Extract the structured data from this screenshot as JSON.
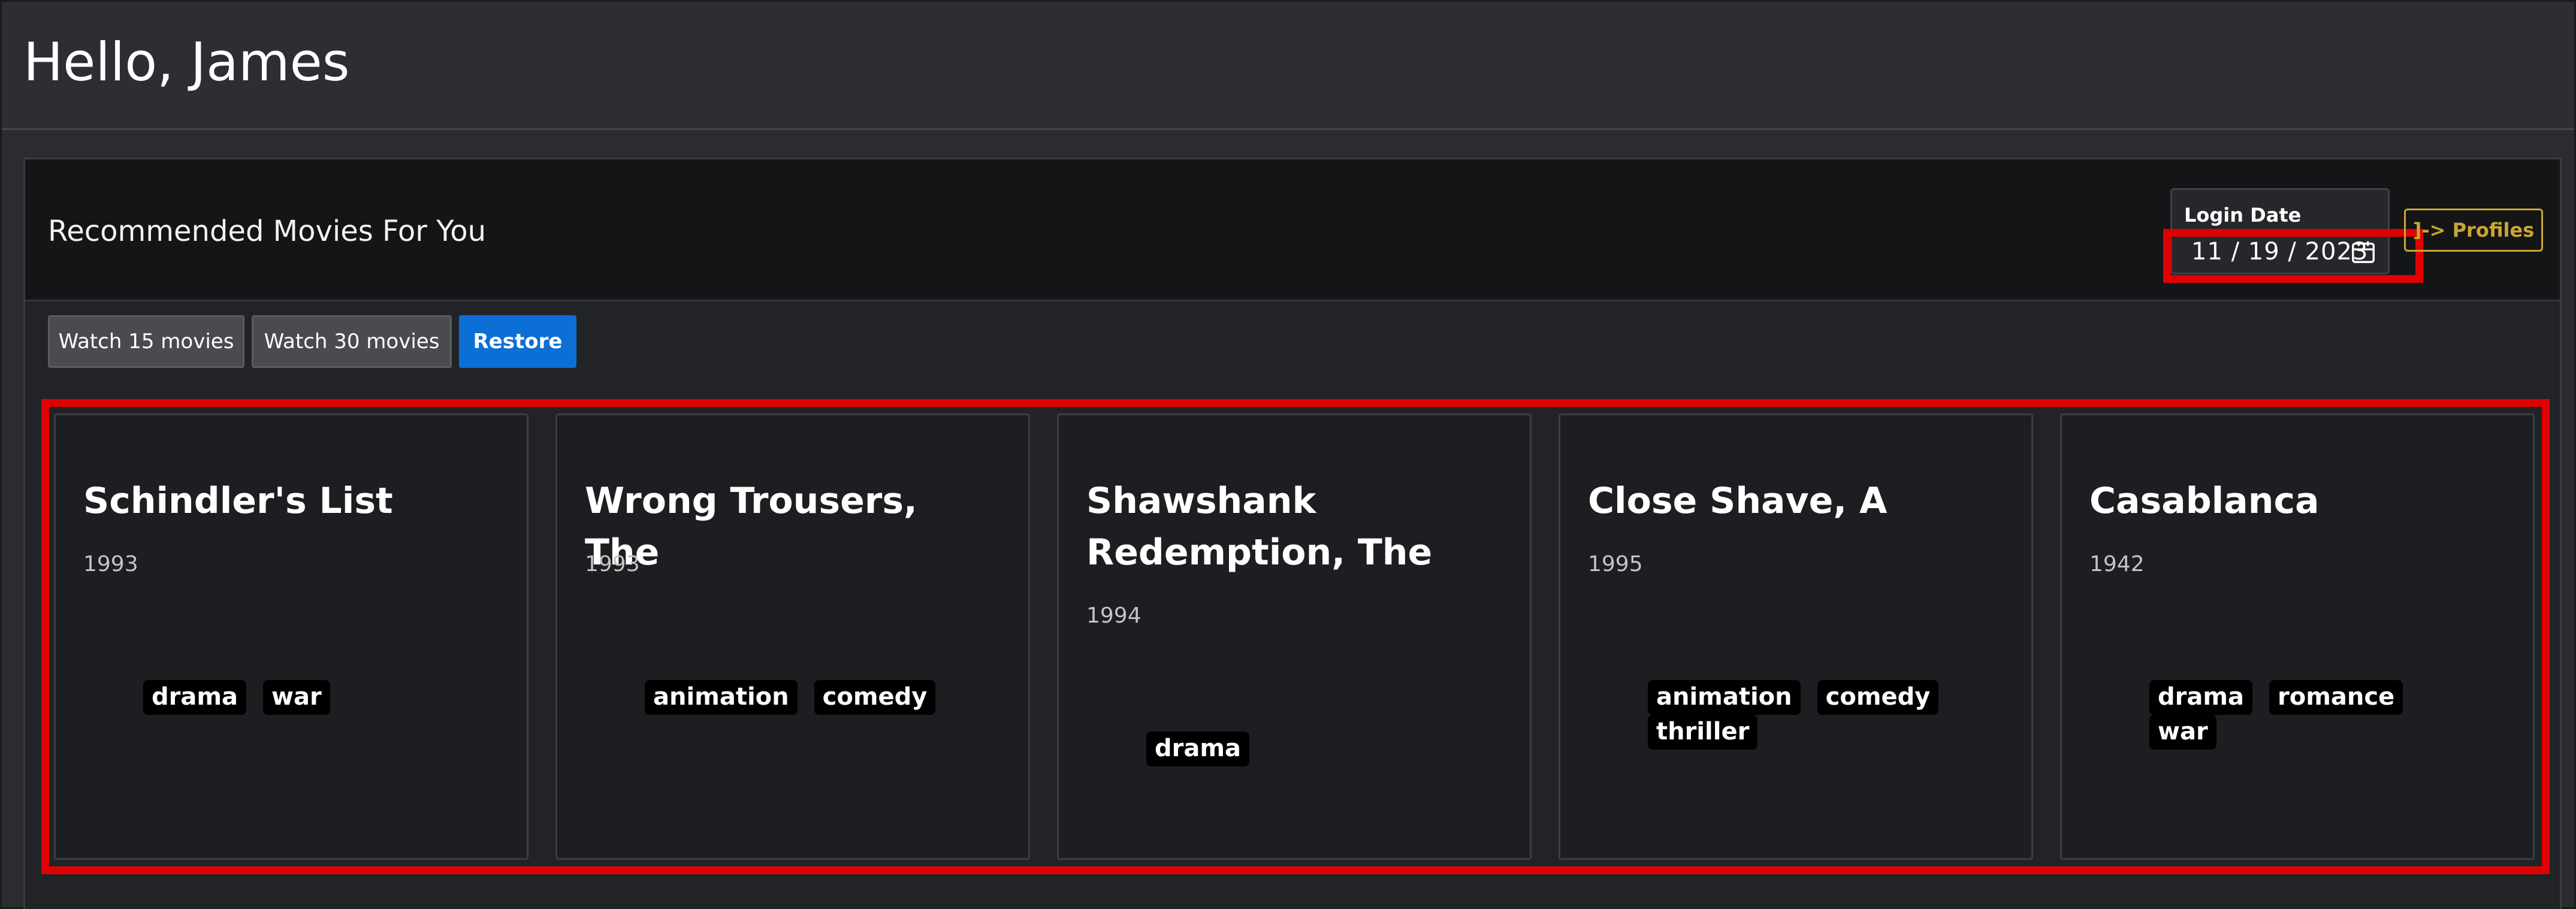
{
  "header": {
    "greeting": "Hello, James"
  },
  "panel": {
    "title": "Recommended Movies For You",
    "login": {
      "label": "Login Date",
      "date": "11 / 19 / 2023"
    },
    "profiles_label": "]-> Profiles"
  },
  "actions": {
    "watch15": "Watch 15 movies",
    "watch30": "Watch 30 movies",
    "restore": "Restore"
  },
  "movies": [
    {
      "title": "Schindler's List",
      "year": "1993",
      "genres": [
        "drama",
        "war"
      ]
    },
    {
      "title": "Wrong Trousers, The",
      "year": "1993",
      "genres": [
        "animation",
        "comedy"
      ]
    },
    {
      "title": "Shawshank Redemption, The",
      "year": "1994",
      "genres": [
        "drama"
      ]
    },
    {
      "title": "Close Shave, A",
      "year": "1995",
      "genres": [
        "animation",
        "comedy",
        "thriller"
      ]
    },
    {
      "title": "Casablanca",
      "year": "1942",
      "genres": [
        "drama",
        "romance",
        "war"
      ]
    }
  ],
  "colors": {
    "highlight": "#e10000",
    "accent_blue": "#0b6fd6",
    "profiles_gold": "#c9a632"
  },
  "icons": {
    "date_picker": "calendar-icon"
  }
}
